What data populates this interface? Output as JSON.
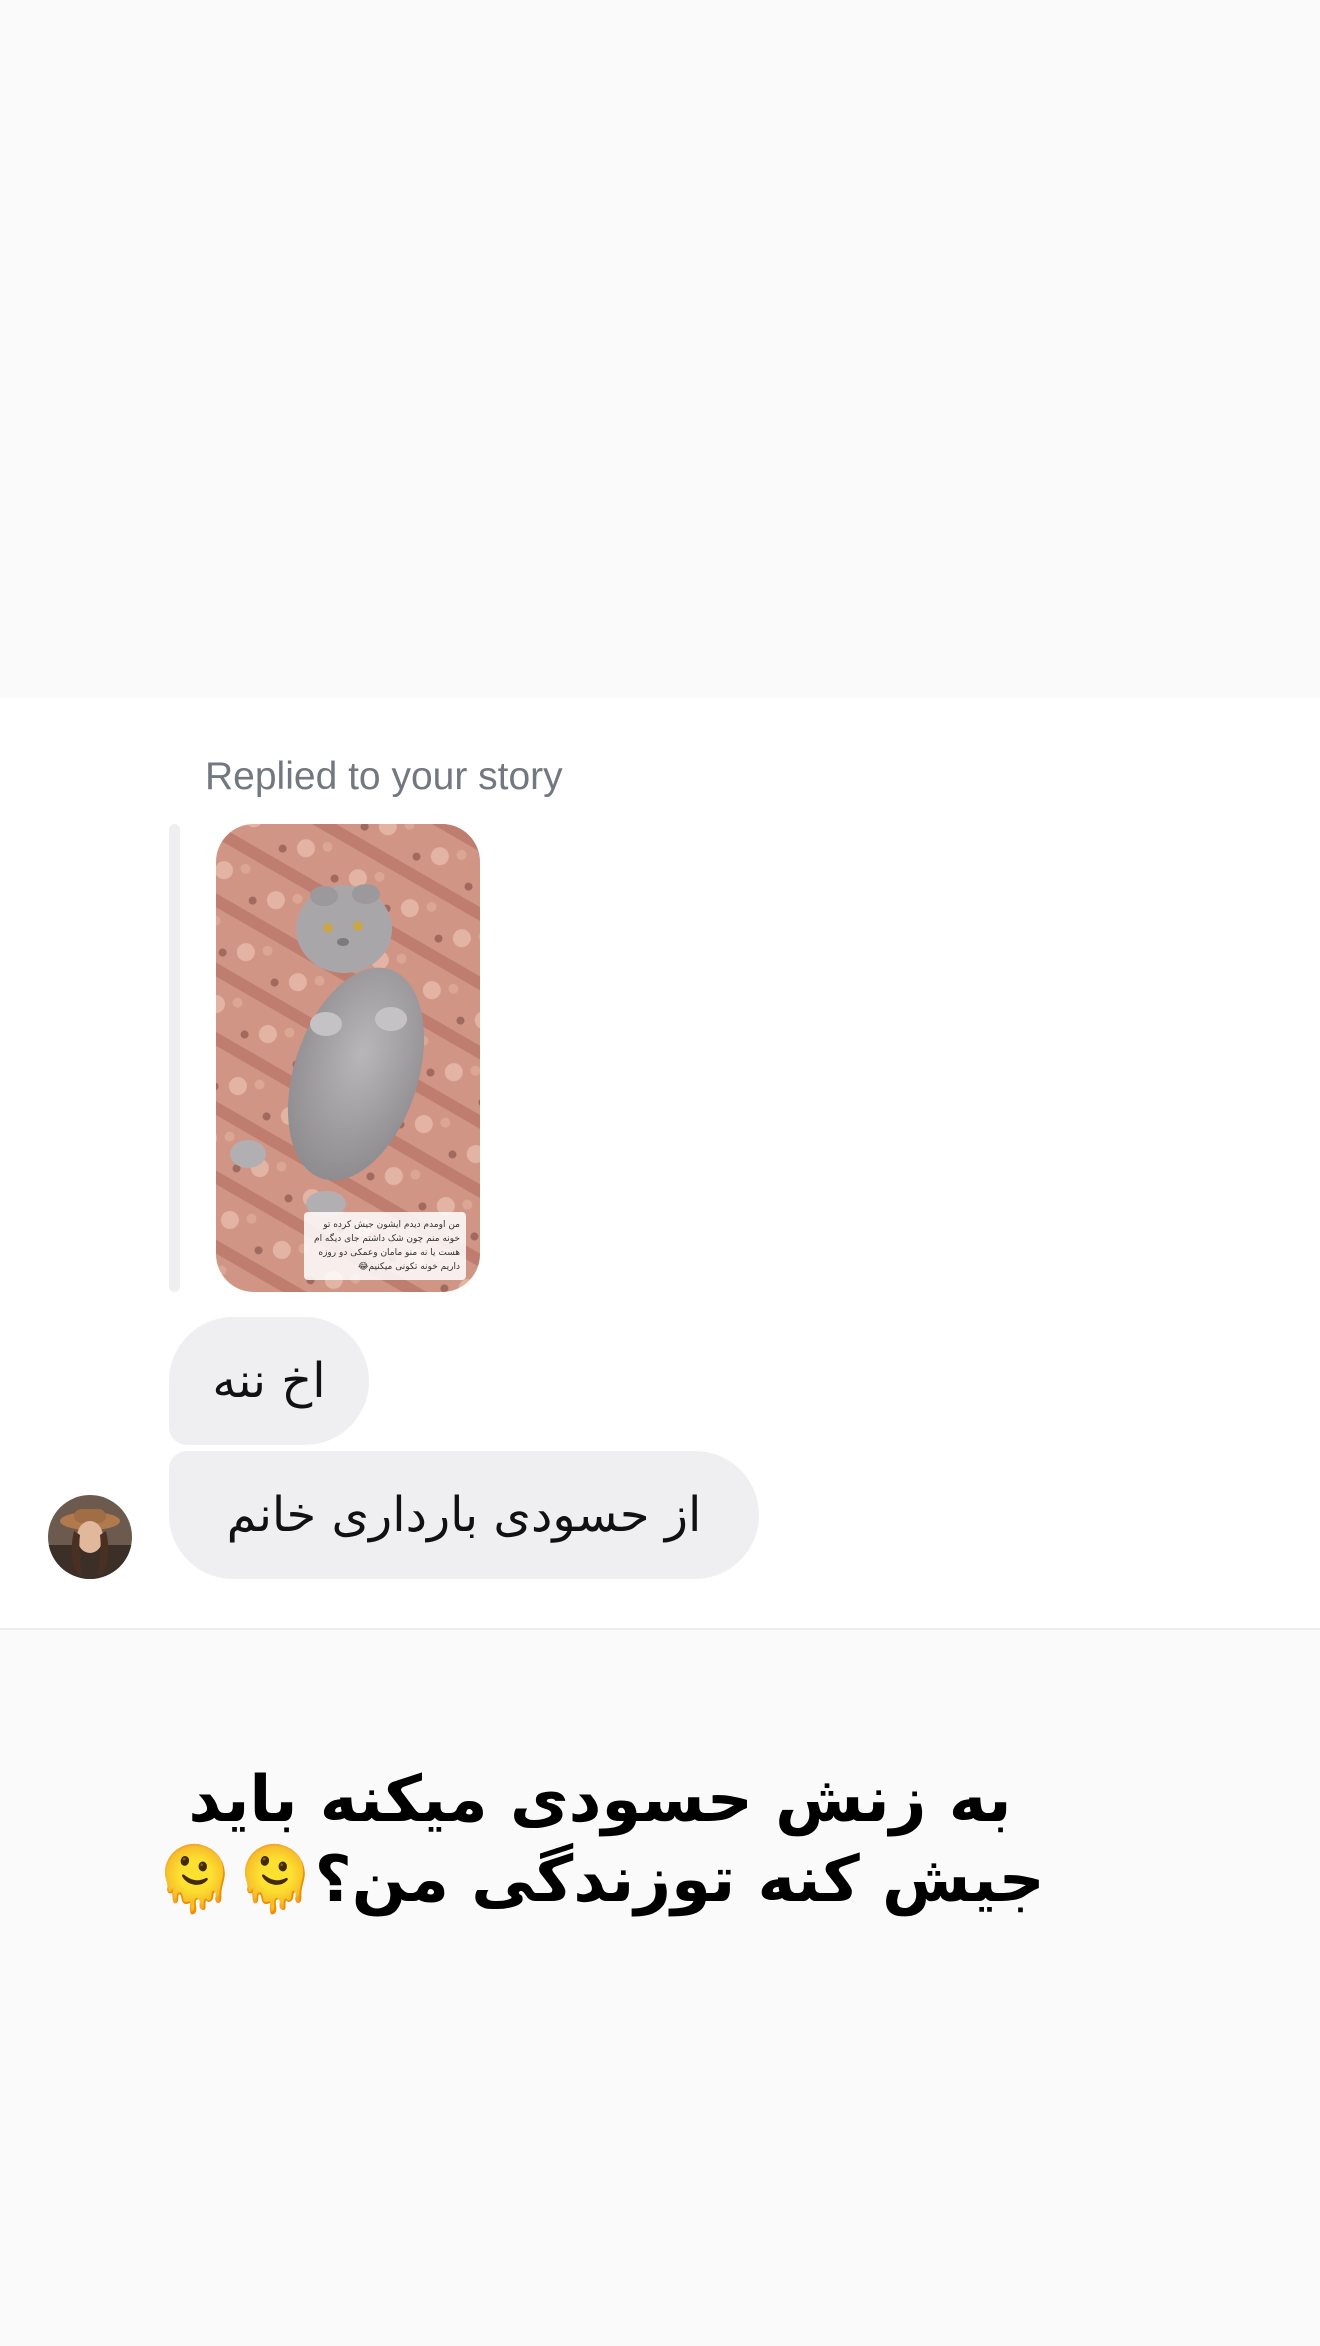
{
  "reply_header": {
    "label": "Replied to your story"
  },
  "story_preview": {
    "caption": "من اومدم دیدم ایشون جیش کرده تو خونه منم چون شک داشتم جای دیگه ام هست یا نه منو مامان وعمکی دو روزه داریم خونه تکونی میکنیم😂"
  },
  "messages": [
    {
      "text": "اخ ننه"
    },
    {
      "text": "از حسودی بارداری خانم"
    }
  ],
  "story_text": {
    "line1": "به زنش حسودی میکنه باید",
    "line2": "جیش کنه توزندگی من؟🫠🫠"
  },
  "icons": {
    "avatar": "profile-avatar",
    "story": "cat-story-image"
  }
}
